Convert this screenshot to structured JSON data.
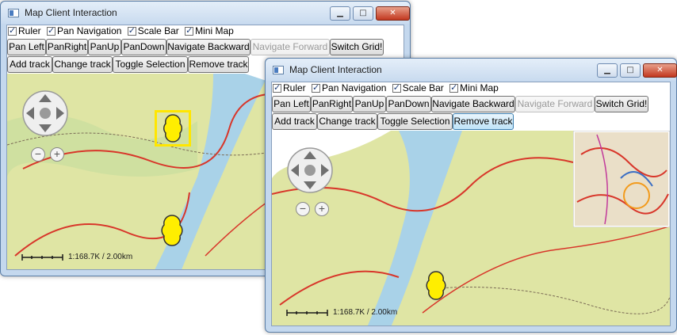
{
  "windows": [
    {
      "title": "Map Client Interaction",
      "checkboxes": [
        {
          "label": "Ruler",
          "checked": true
        },
        {
          "label": "Pan Navigation",
          "checked": true
        },
        {
          "label": "Scale Bar",
          "checked": true
        },
        {
          "label": "Mini Map",
          "checked": true
        }
      ],
      "buttons_row1": [
        "Pan Left",
        "PanRight",
        "PanUp",
        "PanDown",
        "Navigate Backward",
        "Navigate Forward",
        "Switch Grid!"
      ],
      "buttons_row2": [
        "Add track",
        "Change track",
        "Toggle Selection",
        "Remove track"
      ],
      "scale_text": "1:168.7K / 2.00km",
      "zoom_out": "−",
      "zoom_in": "+"
    },
    {
      "title": "Map Client Interaction",
      "checkboxes": [
        {
          "label": "Ruler",
          "checked": true
        },
        {
          "label": "Pan Navigation",
          "checked": true
        },
        {
          "label": "Scale Bar",
          "checked": true
        },
        {
          "label": "Mini Map",
          "checked": true
        }
      ],
      "buttons_row1": [
        "Pan Left",
        "PanRight",
        "PanUp",
        "PanDown",
        "Navigate Backward",
        "Navigate Forward",
        "Switch Grid!"
      ],
      "buttons_row2": [
        "Add track",
        "Change track",
        "Toggle Selection",
        "Remove track"
      ],
      "scale_text": "1:168.7K / 2.00km",
      "zoom_out": "−",
      "zoom_in": "+"
    }
  ],
  "window_controls": {
    "minimize": "▁",
    "maximize": "□",
    "close": "✕"
  },
  "colors": {
    "water": "#a9d2e8",
    "land": "#dfe5a4",
    "forest": "#cfe0a0",
    "road": "#d8362a",
    "track_fill": "#ffee00",
    "selection": "#ffe600"
  },
  "icons": [
    "app-icon",
    "pan-up-icon",
    "pan-down-icon",
    "pan-left-icon",
    "pan-right-icon",
    "zoom-in-icon",
    "zoom-out-icon",
    "track-marker-icon"
  ]
}
